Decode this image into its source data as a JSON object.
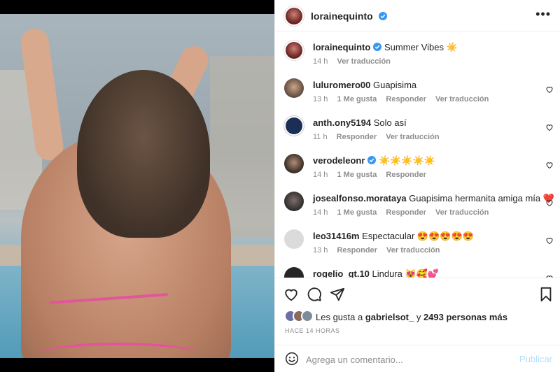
{
  "post": {
    "owner": "lorainequinto",
    "caption_text": "Summer Vibes ☀️",
    "caption_time": "14 h",
    "caption_translate": "Ver traducción"
  },
  "comments": [
    {
      "user": "luluromero00",
      "text": "Guapisima",
      "time": "13 h",
      "likes": "1 Me gusta",
      "reply": "Responder",
      "translate": "Ver traducción",
      "verified": false
    },
    {
      "user": "anth.ony5194",
      "text": "Solo así",
      "time": "11 h",
      "likes": "",
      "reply": "Responder",
      "translate": "Ver traducción",
      "verified": false
    },
    {
      "user": "verodeleonr",
      "text": "☀️☀️☀️☀️☀️",
      "time": "14 h",
      "likes": "1 Me gusta",
      "reply": "Responder",
      "translate": "",
      "verified": true
    },
    {
      "user": "josealfonso.morataya",
      "text": "Guapisima hermanita amiga mía ❤️",
      "time": "14 h",
      "likes": "1 Me gusta",
      "reply": "Responder",
      "translate": "Ver traducción",
      "verified": false
    },
    {
      "user": "leo31416m",
      "text": "Espectacular 😍😍😍😍😍",
      "time": "13 h",
      "likes": "",
      "reply": "Responder",
      "translate": "Ver traducción",
      "verified": false
    },
    {
      "user": "rogelio_gt.10",
      "text": "Lindura 😻🥰💕",
      "time": "",
      "likes": "",
      "reply": "",
      "translate": "",
      "verified": false
    }
  ],
  "likes": {
    "prefix": "Les gusta a",
    "first": "gabrielsot_",
    "middle": "y",
    "others": "2493 personas más"
  },
  "time_ago": "HACE 14 HORAS",
  "composer": {
    "placeholder": "Agrega un comentario...",
    "publish": "Publicar"
  },
  "colors": {
    "verified": "#3897f0",
    "publish_disabled": "#b2dffc",
    "heart_red": "#ed4956"
  },
  "icons": {
    "more": "more-options-icon",
    "like": "heart-icon",
    "comment": "comment-icon",
    "share": "share-icon",
    "save": "bookmark-icon",
    "emoji": "emoji-icon"
  }
}
